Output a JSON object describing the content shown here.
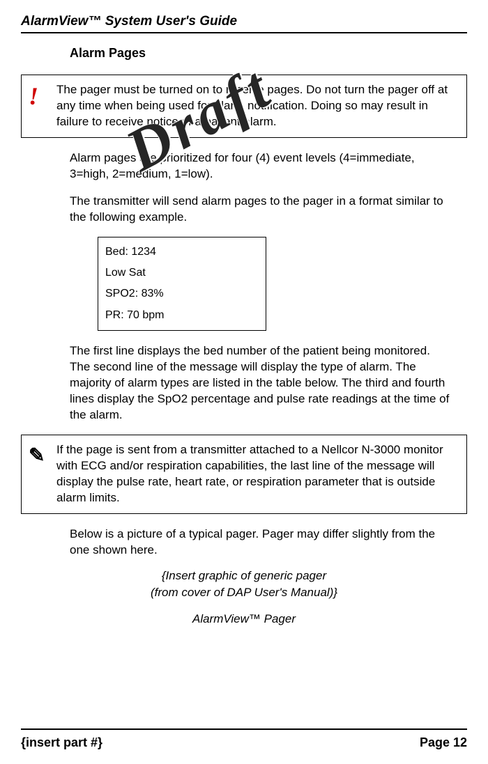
{
  "header": {
    "title": "AlarmView™ System User's Guide"
  },
  "section": {
    "title": "Alarm Pages"
  },
  "watermark": "Draft",
  "warning": {
    "text": "The pager must be turned on to receive pages. Do not turn the pager off at any time when being used for alarm notification. Doing so may result in failure to receive notice of a patient alarm."
  },
  "paragraphs": {
    "priorities": "Alarm pages are prioritized for four (4) event levels (4=immediate, 3=high, 2=medium, 1=low).",
    "transmitter": "The transmitter will send alarm pages to the pager in a format similar to the following example.",
    "explanation": "The first line displays the bed number of the patient being monitored. The second line of the message will display the type of alarm. The majority of alarm types are listed in the table below. The third and fourth lines display the SpO2 percentage and pulse rate readings at the time of the alarm.",
    "below_picture": "Below is a picture of a typical pager. Pager may differ slightly from the one shown here."
  },
  "pager_example": {
    "line1": "Bed: 1234",
    "line2": "Low Sat",
    "line3": "SPO2: 83%",
    "line4": "PR: 70 bpm"
  },
  "note": {
    "text": "If the page is sent from a transmitter attached to a Nellcor N-3000 monitor with ECG and/or respiration capabilities, the last line of the message will display the pulse rate, heart rate, or respiration parameter that is outside alarm limits."
  },
  "insert_graphic": {
    "line1": "{Insert graphic of generic pager",
    "line2": "(from cover of DAP User's Manual)}"
  },
  "caption": "AlarmView™ Pager",
  "footer": {
    "left": "{insert part #}",
    "right": "Page 12"
  }
}
